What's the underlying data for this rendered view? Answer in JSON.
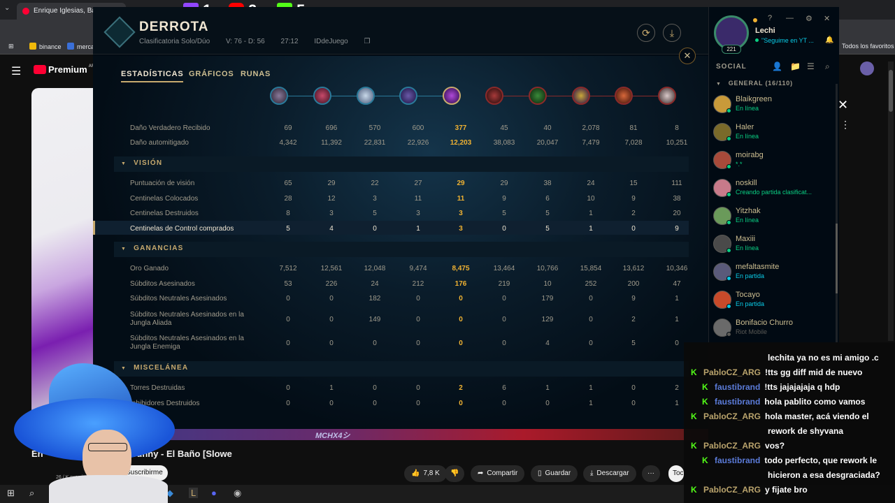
{
  "browser": {
    "tab_title": "Enrique Iglesias, Bad Bunny - El",
    "url": "youtub",
    "bookmarks": [
      "binance",
      "merca"
    ],
    "favorites": "Todos los favoritos"
  },
  "overlay": {
    "twitch_count": "1",
    "youtube_count": "2",
    "kick_count": "5"
  },
  "youtube": {
    "logo": "Premium",
    "logo_sup": "AR",
    "title_left": "En",
    "title_right": "Bunny - El Baño [Slowe",
    "subscribe": "Suscribirme",
    "subs_text": "26 / K suscrip",
    "actions": {
      "like": "7,8 K",
      "share": "Compartir",
      "save": "Guardar",
      "download": "Descargar",
      "more": "···"
    },
    "right_btn": "Toc"
  },
  "lol": {
    "result": "DERROTA",
    "queue": "Clasificatoria Solo/Dúo",
    "score": "V: 76 - D: 56",
    "duration": "27:12",
    "game_id": "IDdeJuego",
    "tabs": [
      "ESTADÍSTICAS",
      "GRÁFICOS",
      "RUNAS"
    ],
    "sections": {
      "vision": "VISIÓN",
      "gold": "GANANCIAS",
      "misc": "MISCELÁNEA"
    },
    "rows_top": [
      {
        "label": "Daño Verdadero Recibido",
        "values": [
          "69",
          "696",
          "570",
          "600",
          "377",
          "45",
          "40",
          "2,078",
          "81",
          "8"
        ]
      },
      {
        "label": "Daño automitigado",
        "values": [
          "4,342",
          "11,392",
          "22,831",
          "22,926",
          "12,203",
          "38,083",
          "20,047",
          "7,479",
          "7,028",
          "10,251"
        ]
      }
    ],
    "rows_vision": [
      {
        "label": "Puntuación de visión",
        "values": [
          "65",
          "29",
          "22",
          "27",
          "29",
          "29",
          "38",
          "24",
          "15",
          "111"
        ]
      },
      {
        "label": "Centinelas Colocados",
        "values": [
          "28",
          "12",
          "3",
          "11",
          "11",
          "9",
          "6",
          "10",
          "9",
          "38"
        ]
      },
      {
        "label": "Centinelas Destruidos",
        "values": [
          "8",
          "3",
          "5",
          "3",
          "3",
          "5",
          "5",
          "1",
          "2",
          "20"
        ]
      },
      {
        "label": "Centinelas de Control comprados",
        "values": [
          "5",
          "4",
          "0",
          "1",
          "3",
          "0",
          "5",
          "1",
          "0",
          "9"
        ]
      }
    ],
    "rows_gold": [
      {
        "label": "Oro Ganado",
        "values": [
          "7,512",
          "12,561",
          "12,048",
          "9,474",
          "8,475",
          "13,464",
          "10,766",
          "15,854",
          "13,612",
          "10,346"
        ]
      },
      {
        "label": "Súbditos Asesinados",
        "values": [
          "53",
          "226",
          "24",
          "212",
          "176",
          "219",
          "10",
          "252",
          "200",
          "47"
        ]
      },
      {
        "label": "Súbditos Neutrales Asesinados",
        "values": [
          "0",
          "0",
          "182",
          "0",
          "0",
          "0",
          "179",
          "0",
          "9",
          "1"
        ]
      },
      {
        "label": "Súbditos Neutrales Asesinados en la Jungla Aliada",
        "values": [
          "0",
          "0",
          "149",
          "0",
          "0",
          "0",
          "129",
          "0",
          "2",
          "1"
        ]
      },
      {
        "label": "Súbditos Neutrales Asesinados en la Jungla Enemiga",
        "values": [
          "0",
          "0",
          "0",
          "0",
          "0",
          "0",
          "4",
          "0",
          "5",
          "0"
        ]
      }
    ],
    "rows_misc": [
      {
        "label": "Torres Destruidas",
        "values": [
          "0",
          "1",
          "0",
          "0",
          "2",
          "6",
          "1",
          "1",
          "0",
          "2"
        ]
      },
      {
        "label": "Inhibidores Destruidos",
        "values": [
          "0",
          "0",
          "0",
          "0",
          "0",
          "0",
          "0",
          "1",
          "0",
          "1"
        ]
      }
    ],
    "bottom_banner": "MCHX4シ",
    "colors": {
      "gold": "#c8aa6e",
      "highlight": "#f0b232",
      "blue_team": "#2a7a9a",
      "red_team": "#8a2a2a"
    }
  },
  "social": {
    "name": "Lechi",
    "status": "\"Seguime en YT ...",
    "level": "221",
    "label": "SOCIAL",
    "group": "GENERAL (16/110)",
    "friends": [
      {
        "name": "Blaikgreen",
        "status": "En línea",
        "kind": "online"
      },
      {
        "name": "Haler",
        "status": "En línea",
        "kind": "online"
      },
      {
        "name": "moirabg",
        "status": "*.*",
        "kind": "online"
      },
      {
        "name": "noskill",
        "status": "Creando partida clasificat...",
        "kind": "online"
      },
      {
        "name": "Yitzhak",
        "status": "En línea",
        "kind": "online"
      },
      {
        "name": "Maxiii",
        "status": "En línea",
        "kind": "online"
      },
      {
        "name": "mefaltasmite",
        "status": "En partida",
        "kind": "ingame"
      },
      {
        "name": "Tocayo",
        "status": "En partida",
        "kind": "ingame"
      },
      {
        "name": "Bonifacio Churro",
        "status": "Riot Mobile",
        "kind": "mobile"
      }
    ]
  },
  "chat": {
    "messages": [
      {
        "user": "",
        "text": "lechita ya no es mi amigo .c",
        "color": "#ffffff"
      },
      {
        "user": "PabloCZ_ARG",
        "text": "!tts gg diff mid de nuevo",
        "color": "#b9a36c"
      },
      {
        "user": "faustibrand",
        "text": "!tts jajajajaja q hdp",
        "color": "#5b7bd8"
      },
      {
        "user": "faustibrand",
        "text": "hola pablito como vamos",
        "color": "#5b7bd8"
      },
      {
        "user": "PabloCZ_ARG",
        "text": "hola master, acá viendo el",
        "color": "#b9a36c"
      },
      {
        "user": "",
        "text": "rework de shyvana",
        "color": "#ffffff"
      },
      {
        "user": "PabloCZ_ARG",
        "text": "vos?",
        "color": "#b9a36c"
      },
      {
        "user": "faustibrand",
        "text": "todo perfecto, que rework le",
        "color": "#5b7bd8"
      },
      {
        "user": "",
        "text": "hicieron a esa desgraciada?",
        "color": "#ffffff"
      },
      {
        "user": "PabloCZ_ARG",
        "text": "y fijate bro",
        "color": "#b9a36c"
      }
    ]
  }
}
